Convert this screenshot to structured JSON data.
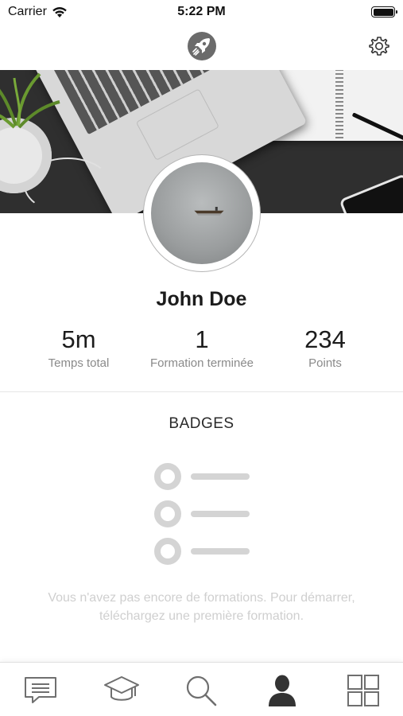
{
  "status_bar": {
    "carrier": "Carrier",
    "time": "5:22 PM",
    "battery_level": 1.0
  },
  "header": {
    "logo_icon": "rocket-icon",
    "settings_icon": "gear-icon"
  },
  "profile": {
    "name": "John Doe",
    "stats": [
      {
        "value": "5m",
        "label": "Temps total"
      },
      {
        "value": "1",
        "label": "Formation terminée"
      },
      {
        "value": "234",
        "label": "Points"
      }
    ]
  },
  "badges": {
    "title": "BADGES",
    "empty_message": "Vous n'avez pas encore de formations. Pour démarrer, téléchargez une première formation."
  },
  "tab_bar": {
    "tabs": [
      {
        "icon": "message-icon",
        "active": false
      },
      {
        "icon": "graduation-cap-icon",
        "active": false
      },
      {
        "icon": "search-icon",
        "active": false
      },
      {
        "icon": "profile-icon",
        "active": true
      },
      {
        "icon": "grid-icon",
        "active": false
      }
    ]
  },
  "colors": {
    "text_primary": "#1c1c1c",
    "text_secondary": "#8a8a8a",
    "placeholder": "#d4d4d4",
    "tab_inactive": "#6f6f6f",
    "tab_active": "#333333"
  }
}
